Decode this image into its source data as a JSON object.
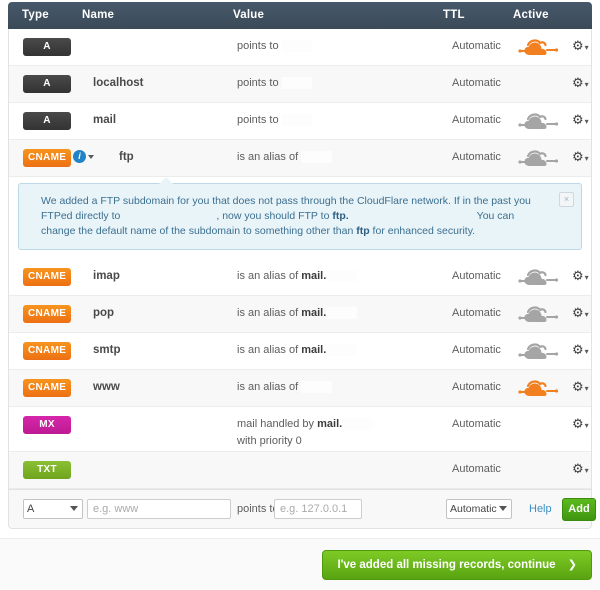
{
  "table": {
    "columns": {
      "type": "Type",
      "name": "Name",
      "value": "Value",
      "ttl": "TTL",
      "active": "Active"
    },
    "rows": [
      {
        "type": "A",
        "name": "",
        "value_prefix": "points to",
        "value_bold": "",
        "value_suffix": "",
        "ttl": "Automatic",
        "cloud": "orange"
      },
      {
        "type": "A",
        "name": "localhost",
        "value_prefix": "points to",
        "value_bold": "",
        "value_suffix": "",
        "ttl": "Automatic",
        "cloud": "none"
      },
      {
        "type": "A",
        "name": "mail",
        "value_prefix": "points to",
        "value_bold": "",
        "value_suffix": "",
        "ttl": "Automatic",
        "cloud": "grey"
      },
      {
        "type": "CNAME",
        "name": "ftp",
        "value_prefix": "is an alias of",
        "value_bold": "",
        "value_suffix": "",
        "ttl": "Automatic",
        "cloud": "grey",
        "info_icon": "i"
      },
      {
        "type": "CNAME",
        "name": "imap",
        "value_prefix": "is an alias of",
        "value_bold": "mail.",
        "value_suffix": "",
        "ttl": "Automatic",
        "cloud": "grey"
      },
      {
        "type": "CNAME",
        "name": "pop",
        "value_prefix": "is an alias of",
        "value_bold": "mail.",
        "value_suffix": "",
        "ttl": "Automatic",
        "cloud": "grey"
      },
      {
        "type": "CNAME",
        "name": "smtp",
        "value_prefix": "is an alias of",
        "value_bold": "mail.",
        "value_suffix": "",
        "ttl": "Automatic",
        "cloud": "grey"
      },
      {
        "type": "CNAME",
        "name": "www",
        "value_prefix": "is an alias of",
        "value_bold": "",
        "value_suffix": "",
        "ttl": "Automatic",
        "cloud": "orange"
      },
      {
        "type": "MX",
        "name": "",
        "value_prefix": "mail handled by",
        "value_bold": "mail.",
        "value_suffix": "",
        "value_line2": "with priority 0",
        "ttl": "Automatic",
        "cloud": "none"
      },
      {
        "type": "TXT",
        "name": "",
        "value_prefix": "",
        "value_bold": "",
        "value_suffix": "",
        "ttl": "Automatic",
        "cloud": "none"
      }
    ]
  },
  "notice": {
    "text_part1": "We added a FTP subdomain for you that does not pass through the CloudFlare network. If in the past you FTPed directly to",
    "text_part2": ", now you should FTP to",
    "bold1": "ftp.",
    "text_part3": "You can change the default name of the subdomain to something other than",
    "bold2": "ftp",
    "text_part4": "for enhanced security.",
    "close_label": "×"
  },
  "add_record": {
    "type_value": "A",
    "name_placeholder": "e.g. www",
    "points_to_label": "points to",
    "value_placeholder": "e.g. 127.0.0.1",
    "ttl_value": "Automatic",
    "help_label": "Help",
    "add_label": "Add"
  },
  "footer": {
    "continue_label": "I've added all missing records, continue",
    "chevron": "❯"
  },
  "colors": {
    "header_bg": "#3f4f5e",
    "cname_orange": "#f38020",
    "mx_magenta": "#cc20a0",
    "txt_green": "#7cb327",
    "a_dark": "#3c3c3c",
    "cloud_active": "#f38020",
    "cloud_inactive": "#a5a5a5",
    "notice_bg": "#e9f4f9",
    "notice_border": "#bcd9e8",
    "continue_green": "#6ab81a",
    "add_green": "#4aa814",
    "link_blue": "#3a8fc4"
  }
}
